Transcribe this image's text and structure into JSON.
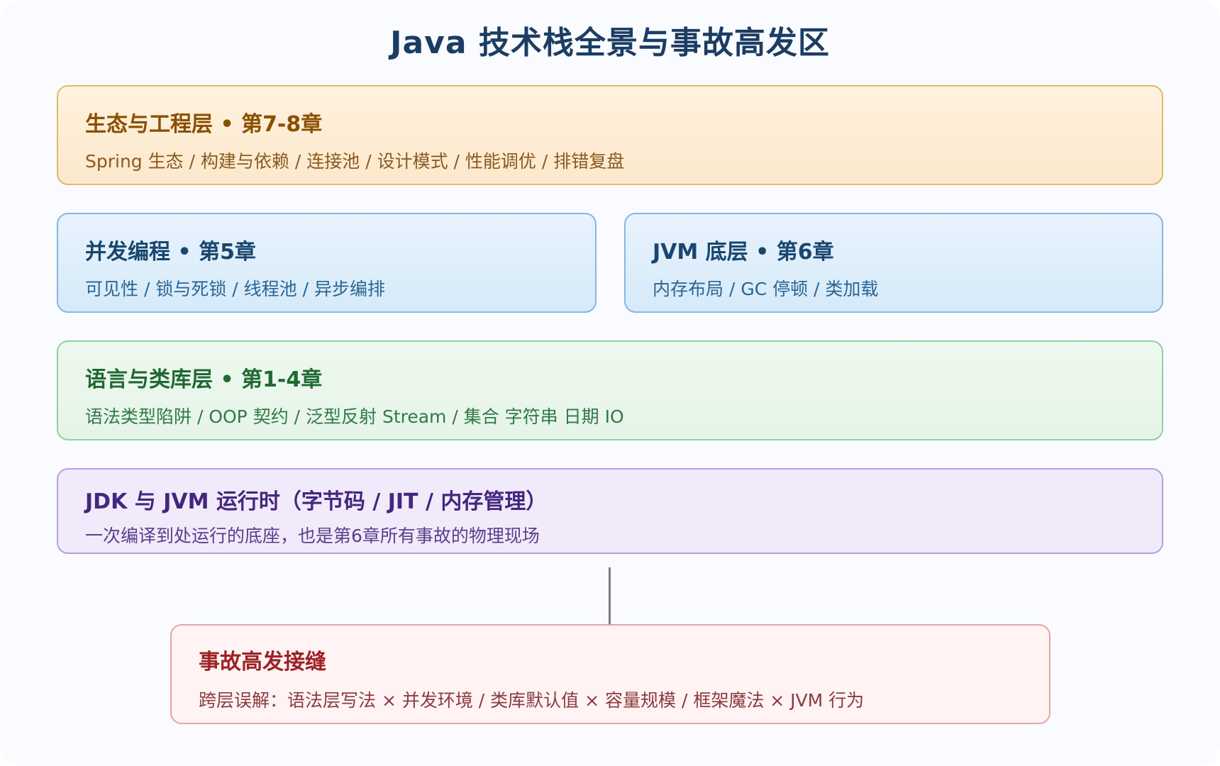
{
  "title": "Java 技术栈全景与事故高发区",
  "layers": {
    "ecosystem": {
      "heading": "生态与工程层 • 第7-8章",
      "items": "Spring 生态 / 构建与依赖 / 连接池 / 设计模式 / 性能调优 / 排错复盘"
    },
    "concurrency": {
      "heading": "并发编程 • 第5章",
      "items": "可见性 / 锁与死锁 / 线程池 / 异步编排"
    },
    "jvm": {
      "heading": "JVM 底层 • 第6章",
      "items": "内存布局 / GC 停顿 / 类加载"
    },
    "language": {
      "heading": "语言与类库层 • 第1-4章",
      "items": "语法类型陷阱 / OOP 契约 / 泛型反射 Stream / 集合 字符串 日期 IO"
    },
    "runtime": {
      "heading": "JDK 与 JVM 运行时（字节码 / JIT / 内存管理）",
      "items": "一次编译到处运行的底座，也是第6章所有事故的物理现场"
    }
  },
  "incident": {
    "heading": "事故高发接缝",
    "items": "跨层误解：语法层写法 × 并发环境 / 类库默认值 × 容量规模 / 框架魔法 × JVM 行为"
  },
  "colors": {
    "title": "#1c3d63",
    "ecosystem_fill": "#fdedd5",
    "ecosystem_border": "#e2b96a",
    "blue_fill": "#dfeefb",
    "blue_border": "#86b7e0",
    "green_fill": "#eaf6eb",
    "green_border": "#92cfa2",
    "purple_fill": "#f1eafa",
    "purple_border": "#b89ce0",
    "red_fill": "#fff3f3",
    "red_border": "#e7a3a6"
  }
}
